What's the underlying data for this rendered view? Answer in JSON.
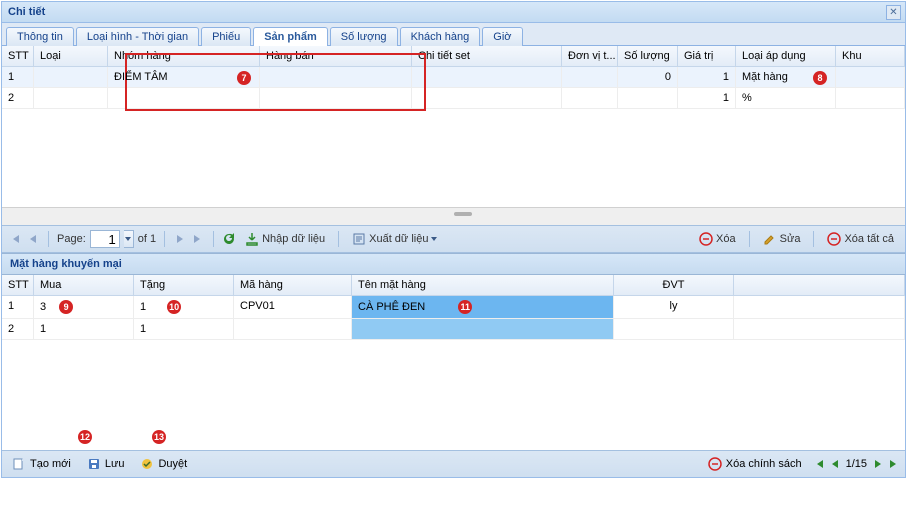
{
  "window": {
    "title": "Chi tiết"
  },
  "tabs": [
    {
      "label": "Thông tin"
    },
    {
      "label": "Loại hình - Thời gian"
    },
    {
      "label": "Phiếu"
    },
    {
      "label": "Sản phẩm",
      "active": true
    },
    {
      "label": "Số lượng"
    },
    {
      "label": "Khách hàng"
    },
    {
      "label": "Giờ"
    }
  ],
  "grid1": {
    "headers": {
      "stt": "STT",
      "loai": "Loại",
      "nhom": "Nhóm hàng",
      "hang": "Hàng bán",
      "chitiet": "Chi tiết set",
      "dvt": "Đơn vị t...",
      "sl": "Số lượng",
      "giatri": "Giá trị",
      "loaiap": "Loại áp dụng",
      "khu": "Khu"
    },
    "rows": [
      {
        "stt": "1",
        "loai": "",
        "nhom": "ĐIỂM TÂM",
        "hang": "",
        "chitiet": "",
        "dvt": "",
        "sl": "0",
        "giatri": "1",
        "loaiap": "Mặt hàng",
        "khu": ""
      },
      {
        "stt": "2",
        "loai": "",
        "nhom": "",
        "hang": "",
        "chitiet": "",
        "dvt": "",
        "sl": "",
        "giatri": "1",
        "loaiap": "%",
        "khu": ""
      }
    ]
  },
  "pager": {
    "page_label": "Page:",
    "page_value": "1",
    "of_label": "of 1",
    "import_label": "Nhập dữ liệu",
    "export_label": "Xuất dữ liệu",
    "delete_label": "Xóa",
    "edit_label": "Sửa",
    "delete_all_label": "Xóa tất cả"
  },
  "section": {
    "title": "Mặt hàng khuyến mại"
  },
  "grid2": {
    "headers": {
      "stt": "STT",
      "mua": "Mua",
      "tang": "Tặng",
      "ma": "Mã hàng",
      "ten": "Tên mặt hàng",
      "dvt": "ĐVT"
    },
    "rows": [
      {
        "stt": "1",
        "mua": "3",
        "tang": "1",
        "ma": "CPV01",
        "ten": "CÀ PHÊ ĐEN",
        "dvt": "ly"
      },
      {
        "stt": "2",
        "mua": "1",
        "tang": "1",
        "ma": "",
        "ten": "",
        "dvt": ""
      }
    ]
  },
  "footer": {
    "new_label": "Tạo mới",
    "save_label": "Lưu",
    "approve_label": "Duyệt",
    "delete_policy_label": "Xóa chính sách",
    "counter": "1/15"
  },
  "badges": {
    "b7": "7",
    "b8": "8",
    "b9": "9",
    "b10": "10",
    "b11": "11",
    "b12": "12",
    "b13": "13"
  }
}
